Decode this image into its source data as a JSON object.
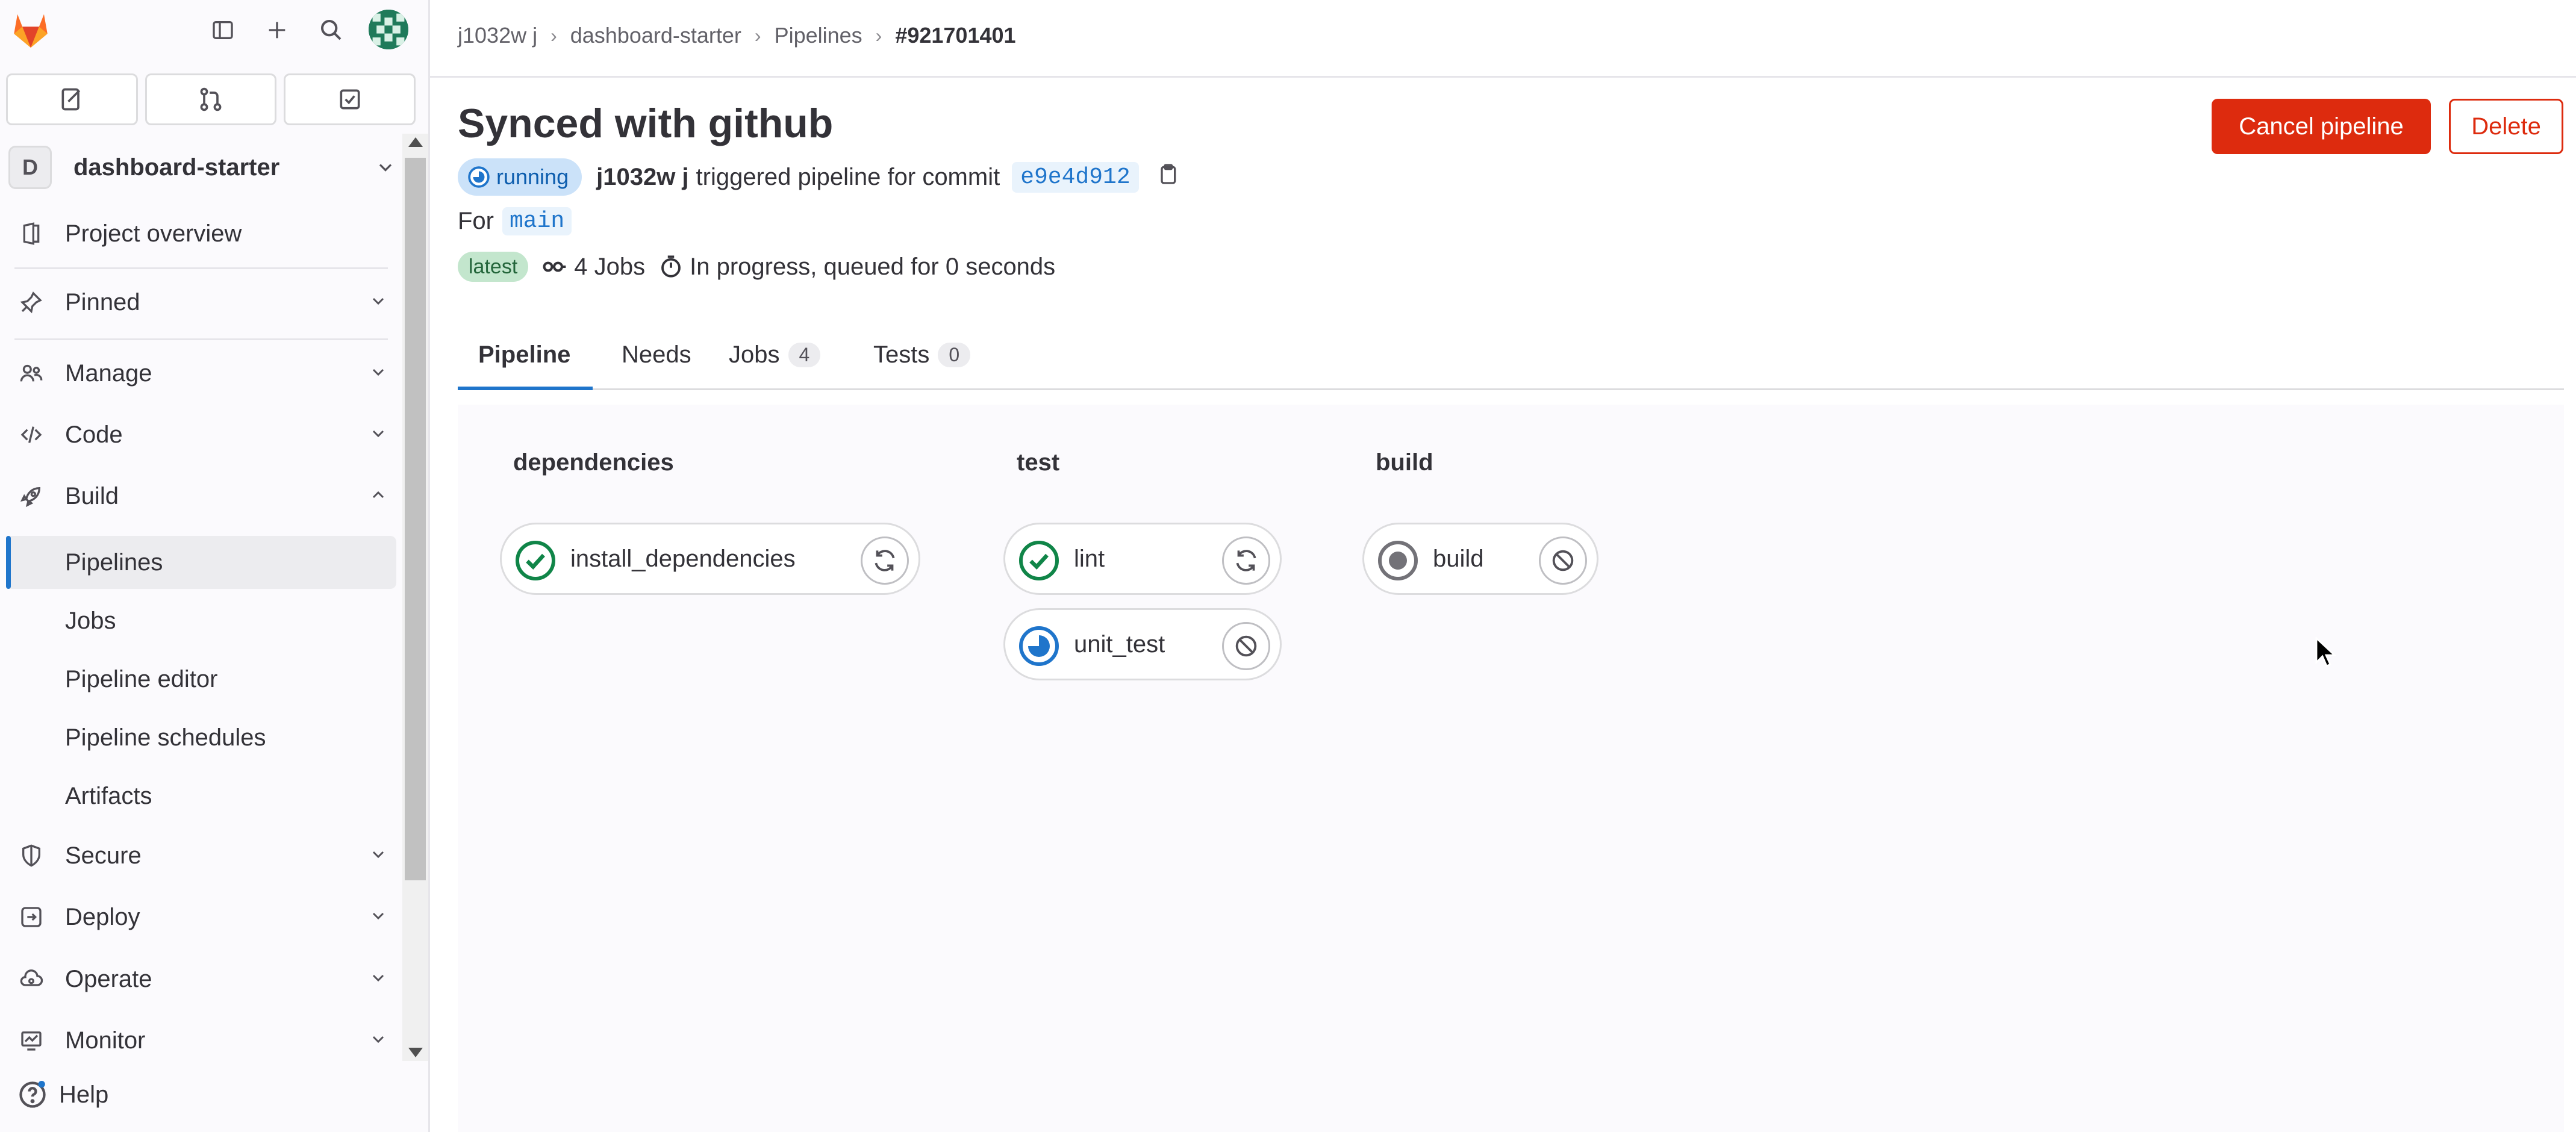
{
  "sidebar": {
    "project_initial": "D",
    "project_name": "dashboard-starter",
    "items": [
      {
        "label": "Project overview",
        "icon": "project-icon"
      },
      {
        "label": "Pinned",
        "icon": "pin-icon"
      },
      {
        "label": "Manage",
        "icon": "users-icon"
      },
      {
        "label": "Code",
        "icon": "code-icon"
      },
      {
        "label": "Build",
        "icon": "rocket-icon"
      },
      {
        "label": "Secure",
        "icon": "shield-icon"
      },
      {
        "label": "Deploy",
        "icon": "deploy-icon"
      },
      {
        "label": "Operate",
        "icon": "cloud-gear-icon"
      },
      {
        "label": "Monitor",
        "icon": "monitor-icon"
      }
    ],
    "build_sub": [
      "Pipelines",
      "Jobs",
      "Pipeline editor",
      "Pipeline schedules",
      "Artifacts"
    ],
    "help": "Help"
  },
  "breadcrumb": [
    "j1032w j",
    "dashboard-starter",
    "Pipelines",
    "#921701401"
  ],
  "header": {
    "title": "Synced with github",
    "cancel_label": "Cancel pipeline",
    "delete_label": "Delete",
    "status": "running",
    "user": "j1032w j",
    "triggered_text": "triggered pipeline for commit",
    "commit": "e9e4d912",
    "for_label": "For",
    "branch": "main",
    "latest": "latest",
    "jobs_summary": "4 Jobs",
    "duration_text": "In progress, queued for 0 seconds"
  },
  "tabs": [
    {
      "label": "Pipeline",
      "count": ""
    },
    {
      "label": "Needs",
      "count": ""
    },
    {
      "label": "Jobs",
      "count": "4"
    },
    {
      "label": "Tests",
      "count": "0"
    }
  ],
  "stages": [
    {
      "name": "dependencies",
      "jobs": [
        {
          "name": "install_dependencies",
          "status": "success",
          "action": "retry"
        }
      ]
    },
    {
      "name": "test",
      "jobs": [
        {
          "name": "lint",
          "status": "success",
          "action": "retry"
        },
        {
          "name": "unit_test",
          "status": "running",
          "action": "cancel"
        }
      ]
    },
    {
      "name": "build",
      "jobs": [
        {
          "name": "build",
          "status": "created",
          "action": "cancel"
        }
      ]
    }
  ],
  "colors": {
    "accent": "#1f75cb",
    "danger": "#dd2b0e",
    "success": "#108548",
    "running": "#1f75cb"
  }
}
